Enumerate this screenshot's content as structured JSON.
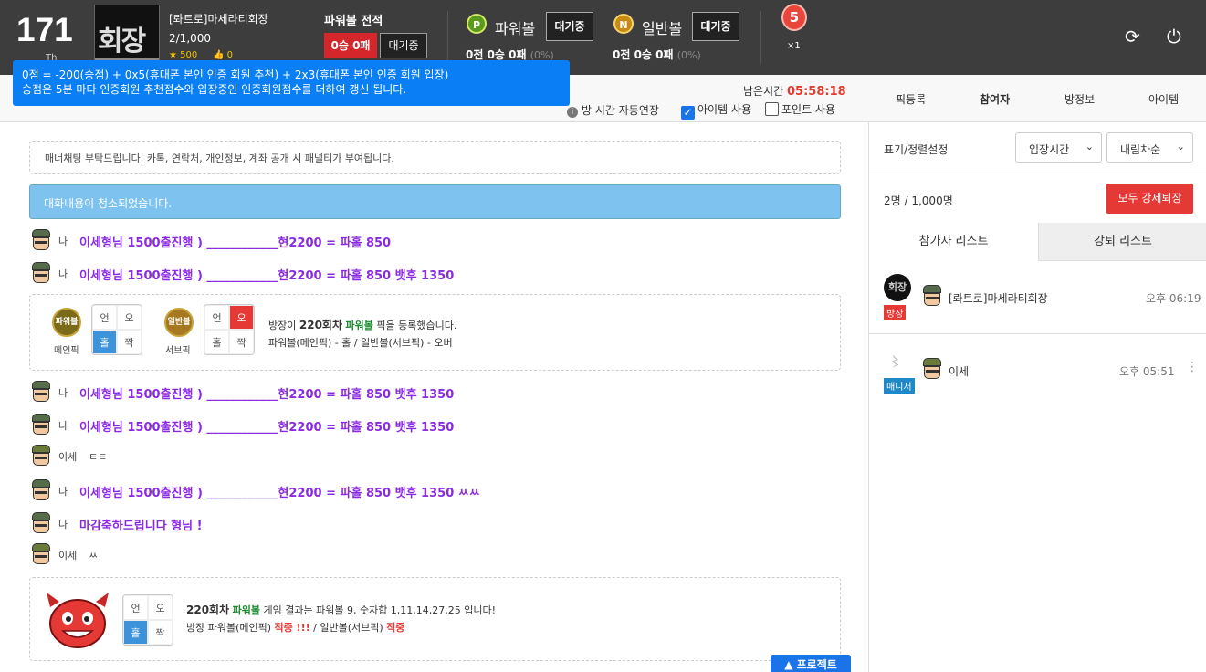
{
  "header": {
    "room_number": "171",
    "room_sub": "Th",
    "logo_text": "회장",
    "room_name": "[롸트로]마세라티회장",
    "user_count": "2/1,000",
    "stars": "★ 500",
    "likes": "👍 0",
    "record_title": "파워볼 전적",
    "record_badge": "0승 0패",
    "record_wait": "대기중",
    "powerball": {
      "icon": "P",
      "name": "파워볼",
      "wait": "대기중",
      "record": "0전 0승 0패",
      "pct": "(0%)"
    },
    "normalball": {
      "icon": "N",
      "name": "일반볼",
      "wait": "대기중",
      "record": "0전 0승 0패",
      "pct": "(0%)"
    },
    "medal_level": "5",
    "medal_count": "×1"
  },
  "tooltip": {
    "line1": "0점 = -200(승점) + 0x5(휴대폰 본인 인증 회원 추천) + 2x3(휴대폰 본인 인증 회원 입장)",
    "line2": "승점은 5분 마다 인증회원 추천점수와 입장중인 인증회원점수를 더하여 갱신 됩니다."
  },
  "subbar": {
    "time_label": "남은시간",
    "time_value": "05:58:18",
    "opt_extend": "방 시간 자동연장",
    "opt_item": "아이템 사용",
    "opt_point": "포인트 사용",
    "tabs": [
      "픽등록",
      "참여자",
      "방정보",
      "아이템"
    ]
  },
  "chat": {
    "manner": "매너채팅 부탁드립니다. 카톡, 연락처, 개인정보, 계좌 공개 시 패널티가 부여됩니다.",
    "cleared": "대화내용이 청소되었습니다.",
    "messages": [
      {
        "who": "나",
        "text": "이세형님 1500출진행 ) ____________현2200 = 파홀 850"
      },
      {
        "who": "나",
        "text": "이세형님 1500출진행 ) ____________현2200 = 파홀 850 뱃후 1350"
      },
      {
        "who": "나",
        "text": "이세형님 1500출진행 ) ____________현2200 = 파홀 850 뱃후 1350"
      },
      {
        "who": "나",
        "text": "이세형님 1500출진행 ) ____________현2200 = 파홀 850 뱃후 1350"
      },
      {
        "who": "이세",
        "text": "ㅌㅌ"
      },
      {
        "who": "나",
        "text": "이세형님 1500출진행 ) ____________현2200 = 파홀 850 뱃후 1350 ㅆㅆ"
      },
      {
        "who": "나",
        "text": "마감축하드립니다 형님 !"
      },
      {
        "who": "이세",
        "text": "ㅆ"
      }
    ],
    "pick": {
      "ball1": "파워볼",
      "ball1_label": "메인픽",
      "ball2": "일반볼",
      "ball2_label": "서브픽",
      "grid": [
        "언",
        "오",
        "홀",
        "짝"
      ],
      "line1_pre": "방장이",
      "line1_round": "220회차",
      "line1_game": "파워볼",
      "line1_post": "픽을 등록했습니다.",
      "line2": "파워볼(메인픽) - 홀 / 일반볼(서브픽) - 오버"
    },
    "result": {
      "round": "220회차",
      "game": "파워볼",
      "line1_post": "게임 결과는 파워볼 9, 숫자합 1,11,14,27,25 입니다!",
      "line2_a": "방장 파워볼(메인픽)",
      "hit1": "적중 !!!",
      "line2_b": "/ 일반볼(서브픽)",
      "hit2": "적중"
    },
    "project_btn": "▲ 프로젝트"
  },
  "sidebar": {
    "sort_label": "표기/정렬설정",
    "sort1": "입장시간",
    "sort2": "내림차순",
    "count": "2명 / 1,000명",
    "kick_all": "모두 강제퇴장",
    "tab1": "참가자 리스트",
    "tab2": "강퇴 리스트",
    "participants": [
      {
        "name": "[롸트로]마세라티회장",
        "time": "오후 06:19",
        "role": "방장"
      },
      {
        "name": "이세",
        "time": "오후 05:51",
        "role": "매니저"
      }
    ]
  }
}
